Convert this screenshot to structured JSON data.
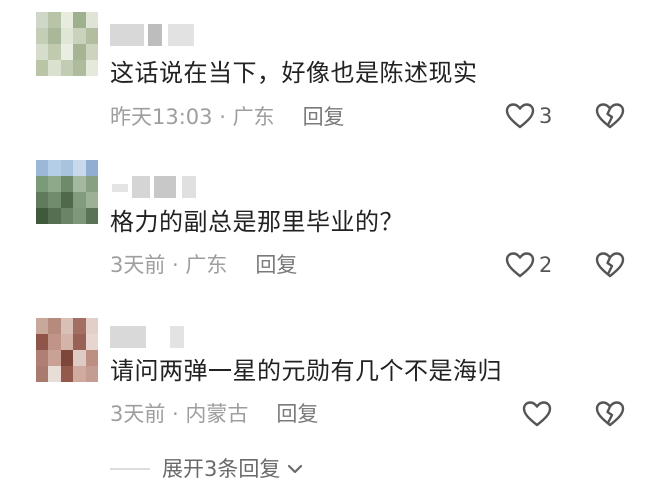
{
  "comments": [
    {
      "text": "这话说在当下，好像也是陈述现实",
      "time": "昨天13:03",
      "sep": " · ",
      "location": "广东",
      "reply_label": "回复",
      "likes": "3",
      "avatar_colors": [
        "#cfd8c8",
        "#b7c4a8",
        "#e7ecdf",
        "#9fb08f",
        "#dfe4d6",
        "#c4cdb6",
        "#aab89a",
        "#e0e6d6",
        "#c9d2bb",
        "#b2be9f",
        "#d6ddcb",
        "#bfcaae",
        "#e9eee2",
        "#a6b493",
        "#ccd4bf",
        "#b9c5a6",
        "#dbe1cf",
        "#c2ccb2",
        "#aebb9c",
        "#e4e9dc"
      ]
    },
    {
      "text": "格力的副总是那里毕业的？",
      "time": "3天前",
      "sep": " · ",
      "location": "广东",
      "reply_label": "回复",
      "likes": "2",
      "avatar_colors": [
        "#9cb8d8",
        "#b5cde6",
        "#a9c3df",
        "#c8d9ec",
        "#90aed2",
        "#7b9a78",
        "#8ea98a",
        "#6e8a6a",
        "#a4b89f",
        "#86a081",
        "#5f7a5c",
        "#718c6c",
        "#4f6a4b",
        "#829b7d",
        "#9cb196",
        "#3f5a3b",
        "#566f52",
        "#6a8465",
        "#7e977a",
        "#5a7356"
      ]
    },
    {
      "text": "请问两弹一星的元勋有几个不是海归",
      "time": "3天前",
      "sep": " · ",
      "location": "内蒙古",
      "reply_label": "回复",
      "likes": "",
      "avatar_colors": [
        "#c9a89c",
        "#b78a7e",
        "#d8c0b7",
        "#a36f64",
        "#e1cfc8",
        "#8f5549",
        "#c09487",
        "#d4b3a8",
        "#9a6256",
        "#e6d6cf",
        "#b07f73",
        "#caa195",
        "#7d463b",
        "#deccc4",
        "#bd8f83",
        "#a97a6e",
        "#e9ddd7",
        "#94594d",
        "#d0aa9e",
        "#c59c90"
      ]
    }
  ],
  "expand": {
    "label": "展开3条回复"
  },
  "icons": {
    "like": "heart-outline-icon",
    "dislike": "broken-heart-icon",
    "expand": "chevron-down-icon"
  },
  "colors": {
    "text": "#222222",
    "meta": "#9e9e9e",
    "icon": "#555555"
  }
}
